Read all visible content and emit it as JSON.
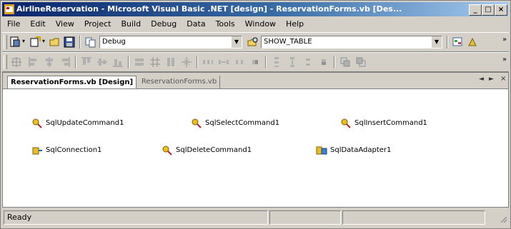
{
  "window": {
    "title": "AirlineReservation - Microsoft Visual Basic .NET [design] - ReservationForms.vb [Des...",
    "minimize_symbol": "_",
    "maximize_symbol": "□",
    "close_symbol": "×"
  },
  "menu": [
    "File",
    "Edit",
    "View",
    "Project",
    "Build",
    "Debug",
    "Data",
    "Tools",
    "Window",
    "Help"
  ],
  "toolbar1": {
    "config_value": "Debug",
    "find_value": "SHOW_TABLE"
  },
  "tabs": {
    "active": "ReservationForms.vb [Design]",
    "inactive": "ReservationForms.vb",
    "nav_left": "◄",
    "nav_right": "►",
    "close": "×"
  },
  "components": [
    {
      "label": "SqlUpdateCommand1",
      "icon": "sql-command-icon"
    },
    {
      "label": "SqlSelectCommand1",
      "icon": "sql-command-icon"
    },
    {
      "label": "SqlInsertCommand1",
      "icon": "sql-command-icon"
    },
    {
      "label": "SqlConnection1",
      "icon": "sql-connection-icon"
    },
    {
      "label": "SqlDeleteCommand1",
      "icon": "sql-command-icon"
    },
    {
      "label": "SqlDataAdapter1",
      "icon": "sql-data-adapter-icon"
    }
  ],
  "status": {
    "text": "Ready"
  }
}
